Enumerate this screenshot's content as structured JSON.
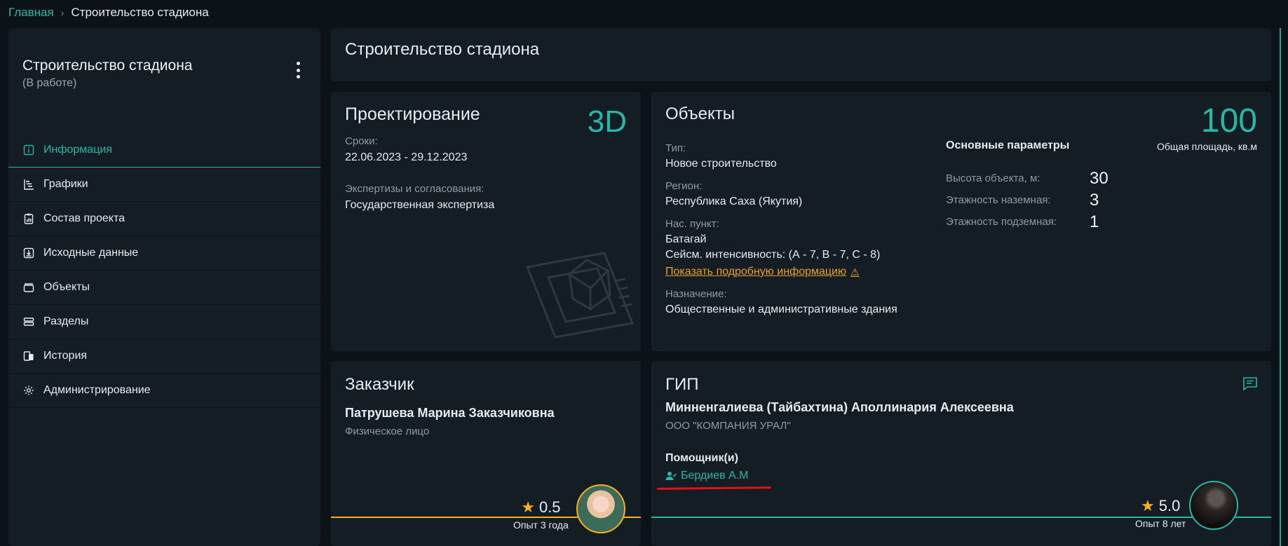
{
  "breadcrumb": {
    "home": "Главная",
    "separator": "›",
    "current": "Строительство стадиона"
  },
  "sidebar": {
    "title": "Строительство стадиона",
    "status": "(В работе)",
    "items": [
      {
        "label": "Информация",
        "icon": "info-icon",
        "active": true
      },
      {
        "label": "Графики",
        "icon": "gantt-icon"
      },
      {
        "label": "Состав проекта",
        "icon": "clipboard-chart-icon"
      },
      {
        "label": "Исходные данные",
        "icon": "download-box-icon"
      },
      {
        "label": "Объекты",
        "icon": "box-icon"
      },
      {
        "label": "Разделы",
        "icon": "sections-icon"
      },
      {
        "label": "История",
        "icon": "history-icon"
      },
      {
        "label": "Администрирование",
        "icon": "gear-icon"
      }
    ]
  },
  "page": {
    "title": "Строительство стадиона"
  },
  "design": {
    "title": "Проектирование",
    "badge": "3D",
    "terms_label": "Сроки:",
    "terms_value": "22.06.2023 - 29.12.2023",
    "expertise_label": "Экспертизы и согласования:",
    "expertise_value": "Государственная экспертиза"
  },
  "objects": {
    "title": "Объекты",
    "type_label": "Тип:",
    "type_value": "Новое строительство",
    "region_label": "Регион:",
    "region_value": "Республика Саха (Якутия)",
    "locality_label": "Нас. пункт:",
    "locality_value": "Батагай",
    "seismic": "Сейсм. интенсивность: (А - 7, В - 7, С - 8)",
    "details_link": "Показать подробную информацию",
    "purpose_label": "Назначение:",
    "purpose_value": "Общественные и административные здания",
    "params_head": "Основные параметры",
    "params": [
      {
        "label": "Высота объекта, м:",
        "value": "30"
      },
      {
        "label": "Этажность наземная:",
        "value": "3"
      },
      {
        "label": "Этажность подземная:",
        "value": "1"
      }
    ],
    "area_value": "100",
    "area_caption": "Общая площадь, кв.м"
  },
  "client": {
    "title": "Заказчик",
    "name": "Патрушева Марина Заказчиковна",
    "type": "Физическое лицо",
    "rating": "0.5",
    "experience": "Опыт 3 года",
    "accent": "#f5b21e"
  },
  "gip": {
    "title": "ГИП",
    "name": "Минненгалиева (Тайбахтина) Аполлинария Алексеевна",
    "org": "ООО \"КОМПАНИЯ УРАЛ\"",
    "assistants_head": "Помощник(и)",
    "assistant": "Бердиев А.М",
    "rating": "5.0",
    "experience": "Опыт 8 лет",
    "accent": "#26b8a5"
  },
  "colors": {
    "accent": "#26b8a5",
    "warning": "#f0a020",
    "star": "#f5b21e",
    "annotation": "#e0121b"
  }
}
